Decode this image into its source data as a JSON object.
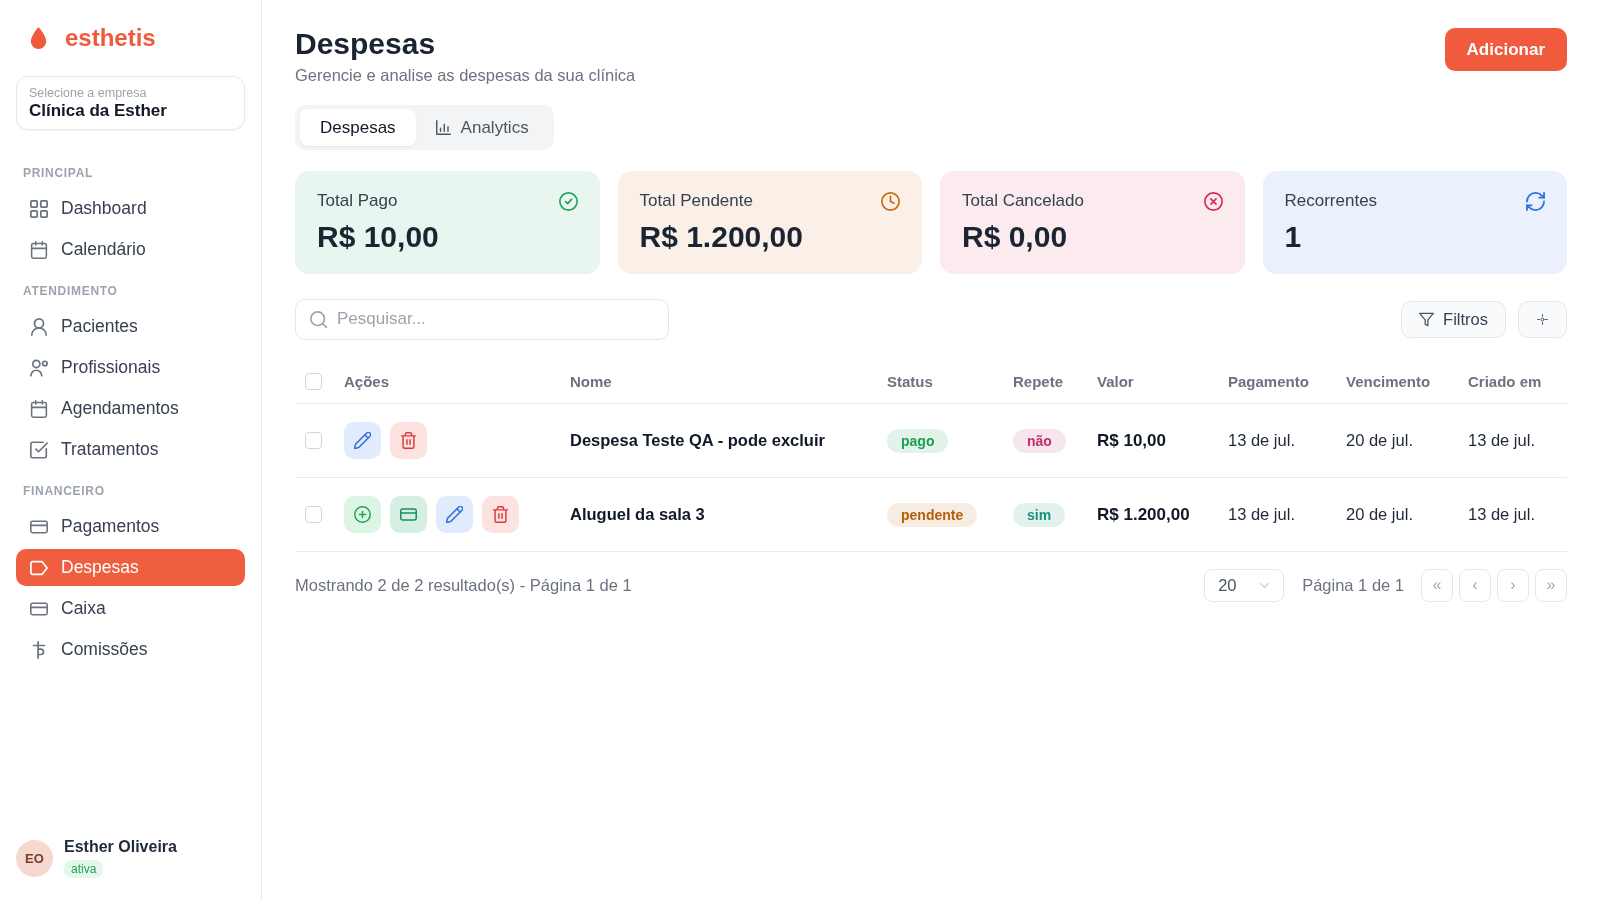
{
  "brand": {
    "name": "esthetis"
  },
  "company_selector": {
    "label": "Selecione a empresa",
    "value": "Clínica da Esther"
  },
  "sidebar": {
    "sections": [
      {
        "title": "PRINCIPAL",
        "items": [
          {
            "label": "Dashboard",
            "selected": false
          },
          {
            "label": "Calendário",
            "selected": false
          }
        ]
      },
      {
        "title": "ATENDIMENTO",
        "items": [
          {
            "label": "Pacientes",
            "selected": false
          },
          {
            "label": "Profissionais",
            "selected": false
          },
          {
            "label": "Agendamentos",
            "selected": false
          },
          {
            "label": "Tratamentos",
            "selected": false
          }
        ]
      },
      {
        "title": "FINANCEIRO",
        "items": [
          {
            "label": "Pagamentos",
            "selected": false
          },
          {
            "label": "Despesas",
            "selected": true
          },
          {
            "label": "Caixa",
            "selected": false
          },
          {
            "label": "Comissões",
            "selected": false
          }
        ]
      }
    ]
  },
  "user": {
    "initials": "EO",
    "name": "Esther Oliveira",
    "status": "ativa"
  },
  "header": {
    "title": "Despesas",
    "subtitle": "Gerencie e analise as despesas da sua clínica",
    "action": "Adicionar"
  },
  "tabs": [
    {
      "label": "Despesas",
      "selected": true
    },
    {
      "label": "Analytics",
      "selected": false
    }
  ],
  "cards": [
    {
      "label": "Total Pago",
      "value": "R$ 10,00",
      "color": "#22a35a"
    },
    {
      "label": "Total Pendente",
      "value": "R$ 1.200,00",
      "color": "#c8690f"
    },
    {
      "label": "Total Cancelado",
      "value": "R$ 0,00",
      "color": "#d42a55"
    },
    {
      "label": "Recorrentes",
      "value": "1",
      "color": "#2f6fe0"
    }
  ],
  "toolbar": {
    "search": {
      "placeholder": "Pesquisar..."
    },
    "filter_button": "Filtros"
  },
  "table": {
    "header_checked": false,
    "columns": [
      "Ações",
      "Nome",
      "Status",
      "Repete",
      "Valor",
      "Pagamento",
      "Vencimento",
      "Criado em"
    ],
    "rows": [
      {
        "selected": false,
        "actions": [
          {
            "kind": "edit"
          },
          {
            "kind": "delete"
          }
        ],
        "name": "Despesa Teste QA - pode excluir",
        "status": {
          "label": "pago",
          "color": "#1e9e4f"
        },
        "repeats": {
          "label": "não",
          "color": "#c0306b"
        },
        "value": "R$ 10,00",
        "payment_date": "13 de jul.",
        "due_date": "20 de jul.",
        "created": "13 de jul."
      },
      {
        "selected": false,
        "actions": [
          {
            "kind": "add"
          },
          {
            "kind": "pay"
          },
          {
            "kind": "edit"
          },
          {
            "kind": "delete"
          }
        ],
        "name": "Aluguel da sala 3",
        "status": {
          "label": "pendente",
          "color": "#b45f0b"
        },
        "repeats": {
          "label": "sim",
          "color": "#14917a"
        },
        "value": "R$ 1.200,00",
        "payment_date": "13 de jul.",
        "due_date": "20 de jul.",
        "created": "13 de jul."
      }
    ]
  },
  "pagination": {
    "summary": "Mostrando 2 de 2 resultado(s) - Página 1 de 1",
    "page_size": "20",
    "page_label": "Página 1 de 1",
    "buttons": [
      {
        "label": "«",
        "disabled": true
      },
      {
        "label": "‹",
        "disabled": true
      },
      {
        "label": "›",
        "disabled": true
      },
      {
        "label": "»",
        "disabled": true
      }
    ]
  }
}
